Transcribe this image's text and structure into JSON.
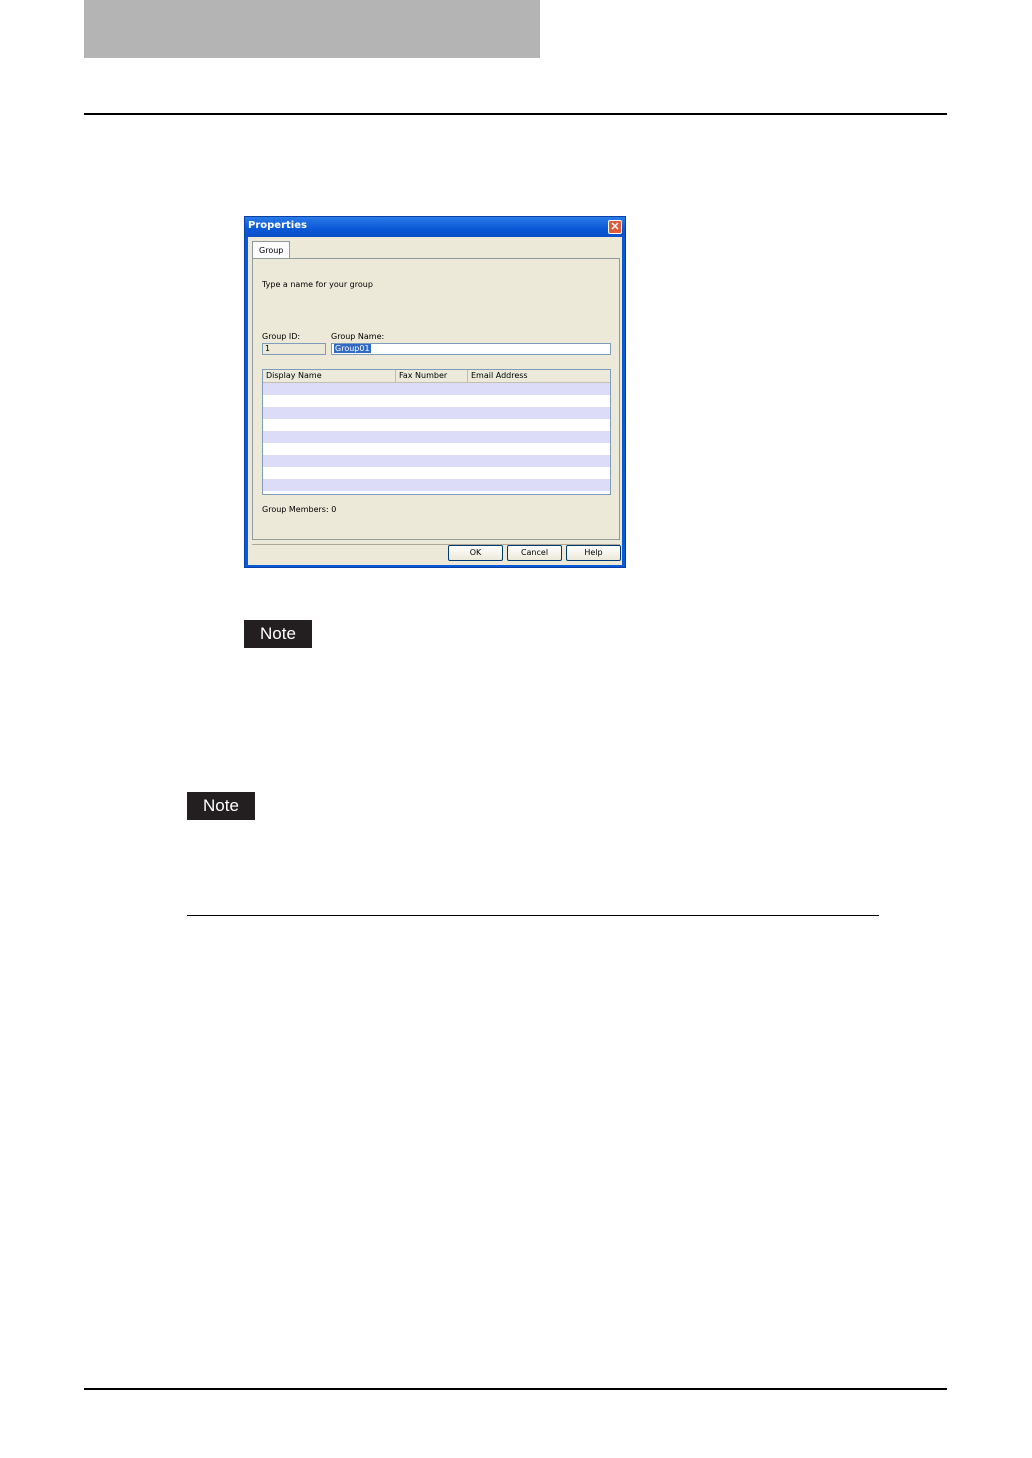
{
  "dialog": {
    "title": "Properties",
    "close_glyph": "✕",
    "tab_label": "Group",
    "instruction": "Type a name for your group",
    "group_id_label": "Group ID:",
    "group_id_value": "1",
    "group_name_label": "Group Name:",
    "group_name_value": "Group01",
    "columns": [
      "Display Name",
      "Fax Number",
      "Email Address"
    ],
    "members_label": "Group Members: 0",
    "buttons": {
      "ok": "OK",
      "cancel": "Cancel",
      "help": "Help"
    }
  },
  "notes": [
    "Note",
    "Note"
  ],
  "colors": {
    "header_bar": "#b4b4b4",
    "title_bar": "#0a58d6",
    "row_alt": "#dcdcf8",
    "note_bg": "#231f20"
  }
}
